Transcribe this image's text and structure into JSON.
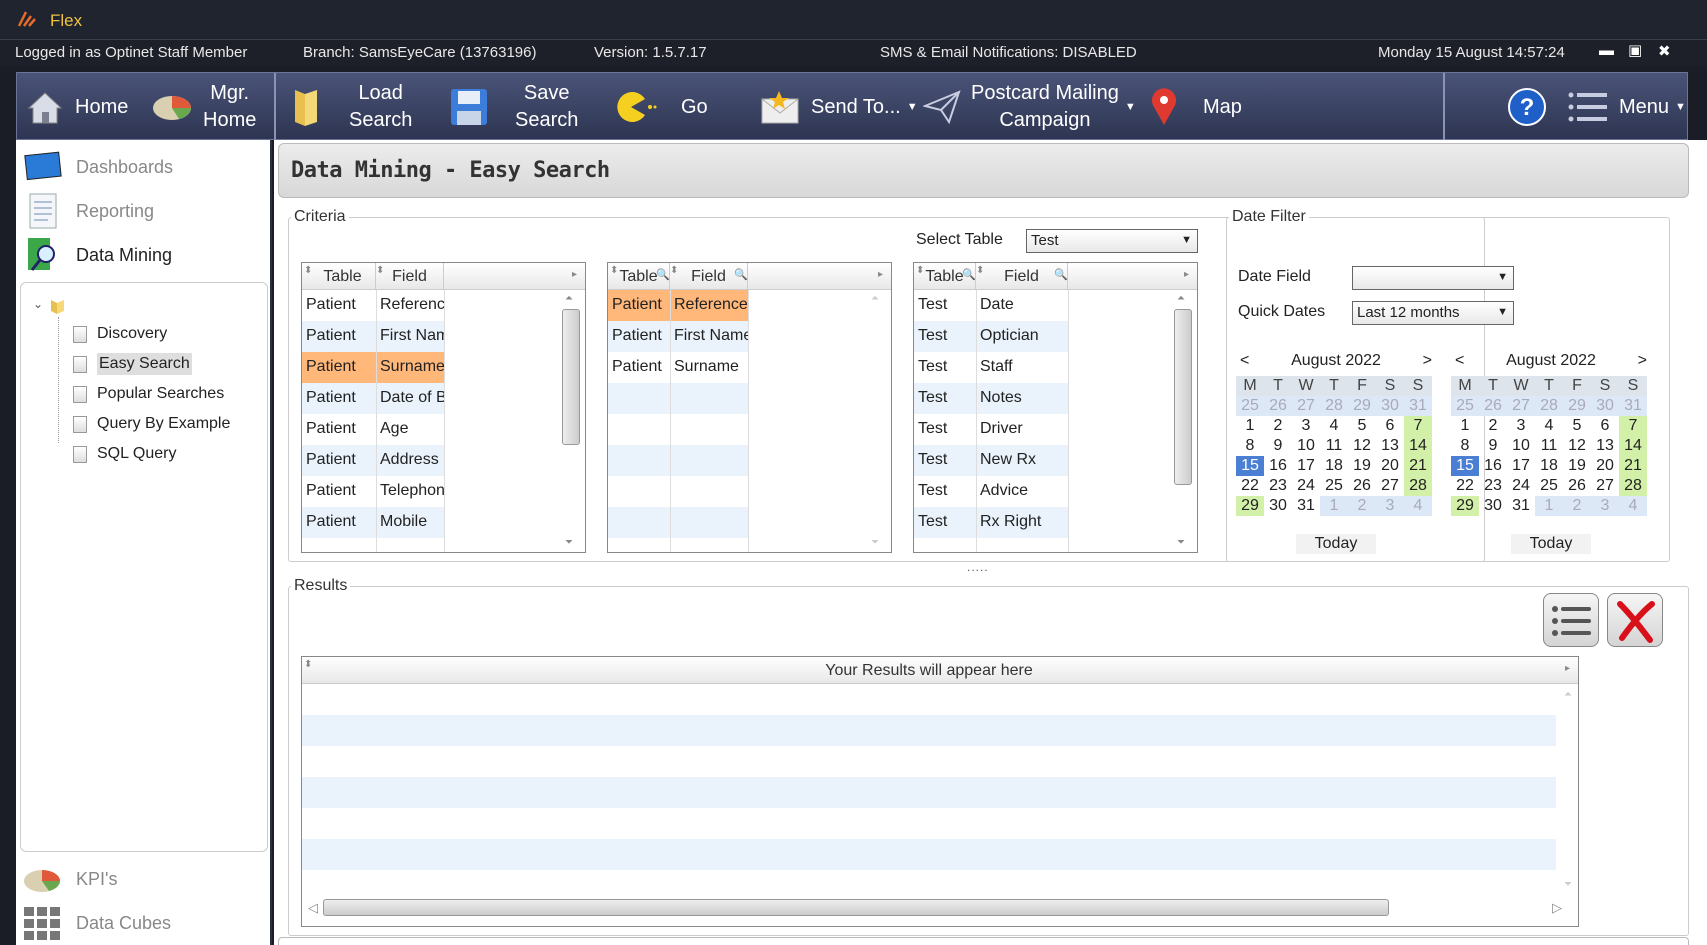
{
  "app": {
    "title": "Flex"
  },
  "status": {
    "user": "Logged in as Optinet Staff Member",
    "branch": "Branch: SamsEyeCare (13763196)",
    "version": "Version: 1.5.7.17",
    "notifications": "SMS & Email Notifications: DISABLED",
    "datetime": "Monday 15 August 14:57:24"
  },
  "window": {
    "minimize": "▬",
    "maximize": "▣",
    "close": "✖"
  },
  "toolbar": {
    "home": "Home",
    "mgr_home_1": "Mgr.",
    "mgr_home_2": "Home",
    "load_1": "Load",
    "load_2": "Search",
    "save_1": "Save",
    "save_2": "Search",
    "go": "Go",
    "send_to": "Send To...",
    "postcard_1": "Postcard Mailing",
    "postcard_2": "Campaign",
    "map": "Map",
    "help": "?",
    "menu": "Menu"
  },
  "sidebar": {
    "nav": [
      {
        "label": "Dashboards",
        "active": false
      },
      {
        "label": "Reporting",
        "active": false
      },
      {
        "label": "Data Mining",
        "active": true
      }
    ],
    "tree": [
      {
        "label": "Discovery",
        "selected": false
      },
      {
        "label": "Easy Search",
        "selected": true
      },
      {
        "label": "Popular Searches",
        "selected": false
      },
      {
        "label": "Query By Example",
        "selected": false
      },
      {
        "label": "SQL Query",
        "selected": false
      }
    ],
    "bottom_nav": [
      {
        "label": "KPI's"
      },
      {
        "label": "Data Cubes"
      }
    ]
  },
  "page": {
    "title": "Data Mining - Easy Search"
  },
  "criteria": {
    "label": "Criteria",
    "select_table_label": "Select Table",
    "select_table_value": "Test",
    "col_table": "Table",
    "col_field": "Field",
    "grid1": [
      [
        "Patient",
        "Reference"
      ],
      [
        "Patient",
        "First Name"
      ],
      [
        "Patient",
        "Surname"
      ],
      [
        "Patient",
        "Date of Birth"
      ],
      [
        "Patient",
        "Age"
      ],
      [
        "Patient",
        "Address"
      ],
      [
        "Patient",
        "Telephone"
      ],
      [
        "Patient",
        "Mobile"
      ]
    ],
    "grid2": [
      [
        "Patient",
        "Reference"
      ],
      [
        "Patient",
        "First Name"
      ],
      [
        "Patient",
        "Surname"
      ]
    ],
    "grid3": [
      [
        "Test",
        "Date"
      ],
      [
        "Test",
        "Optician"
      ],
      [
        "Test",
        "Staff"
      ],
      [
        "Test",
        "Notes"
      ],
      [
        "Test",
        "Driver"
      ],
      [
        "Test",
        "New Rx"
      ],
      [
        "Test",
        "Advice"
      ],
      [
        "Test",
        "Rx Right"
      ]
    ]
  },
  "date_filter": {
    "label": "Date Filter",
    "date_field_label": "Date Field",
    "date_field_value": "",
    "quick_dates_label": "Quick Dates",
    "quick_dates_value": "Last 12 months",
    "calendar": {
      "month": "August 2022",
      "prev": "<",
      "next": ">",
      "dow": [
        "M",
        "T",
        "W",
        "T",
        "F",
        "S",
        "S"
      ],
      "weeks": [
        [
          "25",
          "26",
          "27",
          "28",
          "29",
          "30",
          "31"
        ],
        [
          "1",
          "2",
          "3",
          "4",
          "5",
          "6",
          "7"
        ],
        [
          "8",
          "9",
          "10",
          "11",
          "12",
          "13",
          "14"
        ],
        [
          "15",
          "16",
          "17",
          "18",
          "19",
          "20",
          "21"
        ],
        [
          "22",
          "23",
          "24",
          "25",
          "26",
          "27",
          "28"
        ],
        [
          "29",
          "30",
          "31",
          "1",
          "2",
          "3",
          "4"
        ]
      ],
      "today_label": "Today"
    }
  },
  "results": {
    "label": "Results",
    "placeholder": "Your Results will appear here",
    "splitter": "....."
  },
  "colors": {
    "highlight": "#ffb77a",
    "weekend": "#d2f0a8",
    "today": "#4a7fd4",
    "alt_row": "#eaf3fc",
    "toolbar": "#3a4263"
  }
}
